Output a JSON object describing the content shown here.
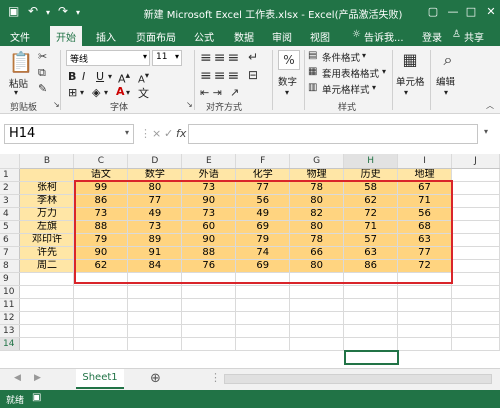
{
  "window": {
    "title": "新建 Microsoft Excel 工作表.xlsx - Excel(产品激活失败)",
    "save_icon": "save-icon",
    "undo_icon": "undo-icon",
    "redo_icon": "redo-icon"
  },
  "tabs": [
    "文件",
    "开始",
    "插入",
    "页面布局",
    "公式",
    "数据",
    "审阅",
    "视图"
  ],
  "tell_me": "告诉我...",
  "login": "登录",
  "share": "共享",
  "ribbon": {
    "paste": "粘贴",
    "clipboard": "剪贴板",
    "font_name": "等线",
    "font_size": "11",
    "bold": "B",
    "italic": "I",
    "underline": "U",
    "font_group": "字体",
    "align_group": "对齐方式",
    "number_btn": "数字",
    "percent": "%",
    "cond_format": "条件格式",
    "table_format": "套用表格格式",
    "cell_styles": "单元格样式",
    "styles_group": "样式",
    "cells_btn": "单元格",
    "edit_btn": "编辑"
  },
  "formula": {
    "name_box": "H14",
    "cancel": "×",
    "enter": "✓",
    "fx": "fx",
    "value": ""
  },
  "columns": [
    "B",
    "C",
    "D",
    "E",
    "F",
    "G",
    "H",
    "I",
    "J"
  ],
  "rows": [
    "1",
    "2",
    "3",
    "4",
    "5",
    "6",
    "7",
    "8",
    "9",
    "10",
    "11",
    "12",
    "13",
    "14"
  ],
  "headers": [
    "",
    "语文",
    "数学",
    "外语",
    "化学",
    "物理",
    "历史",
    "地理"
  ],
  "students": [
    {
      "name": "张柯",
      "scores": [
        "99",
        "80",
        "73",
        "77",
        "78",
        "58",
        "67"
      ]
    },
    {
      "name": "李林",
      "scores": [
        "86",
        "77",
        "90",
        "56",
        "80",
        "62",
        "71"
      ]
    },
    {
      "name": "万力",
      "scores": [
        "73",
        "49",
        "73",
        "49",
        "82",
        "72",
        "56"
      ]
    },
    {
      "name": "左旗",
      "scores": [
        "88",
        "73",
        "60",
        "69",
        "80",
        "71",
        "68"
      ]
    },
    {
      "name": "邓印许",
      "scores": [
        "79",
        "89",
        "90",
        "79",
        "78",
        "57",
        "63"
      ]
    },
    {
      "name": "许先",
      "scores": [
        "90",
        "91",
        "88",
        "74",
        "66",
        "63",
        "77"
      ]
    },
    {
      "name": "周二",
      "scores": [
        "62",
        "84",
        "76",
        "69",
        "80",
        "86",
        "72"
      ]
    }
  ],
  "sheet": {
    "tab": "Sheet1",
    "add": "⊕"
  },
  "status": {
    "ready": "就绪"
  }
}
